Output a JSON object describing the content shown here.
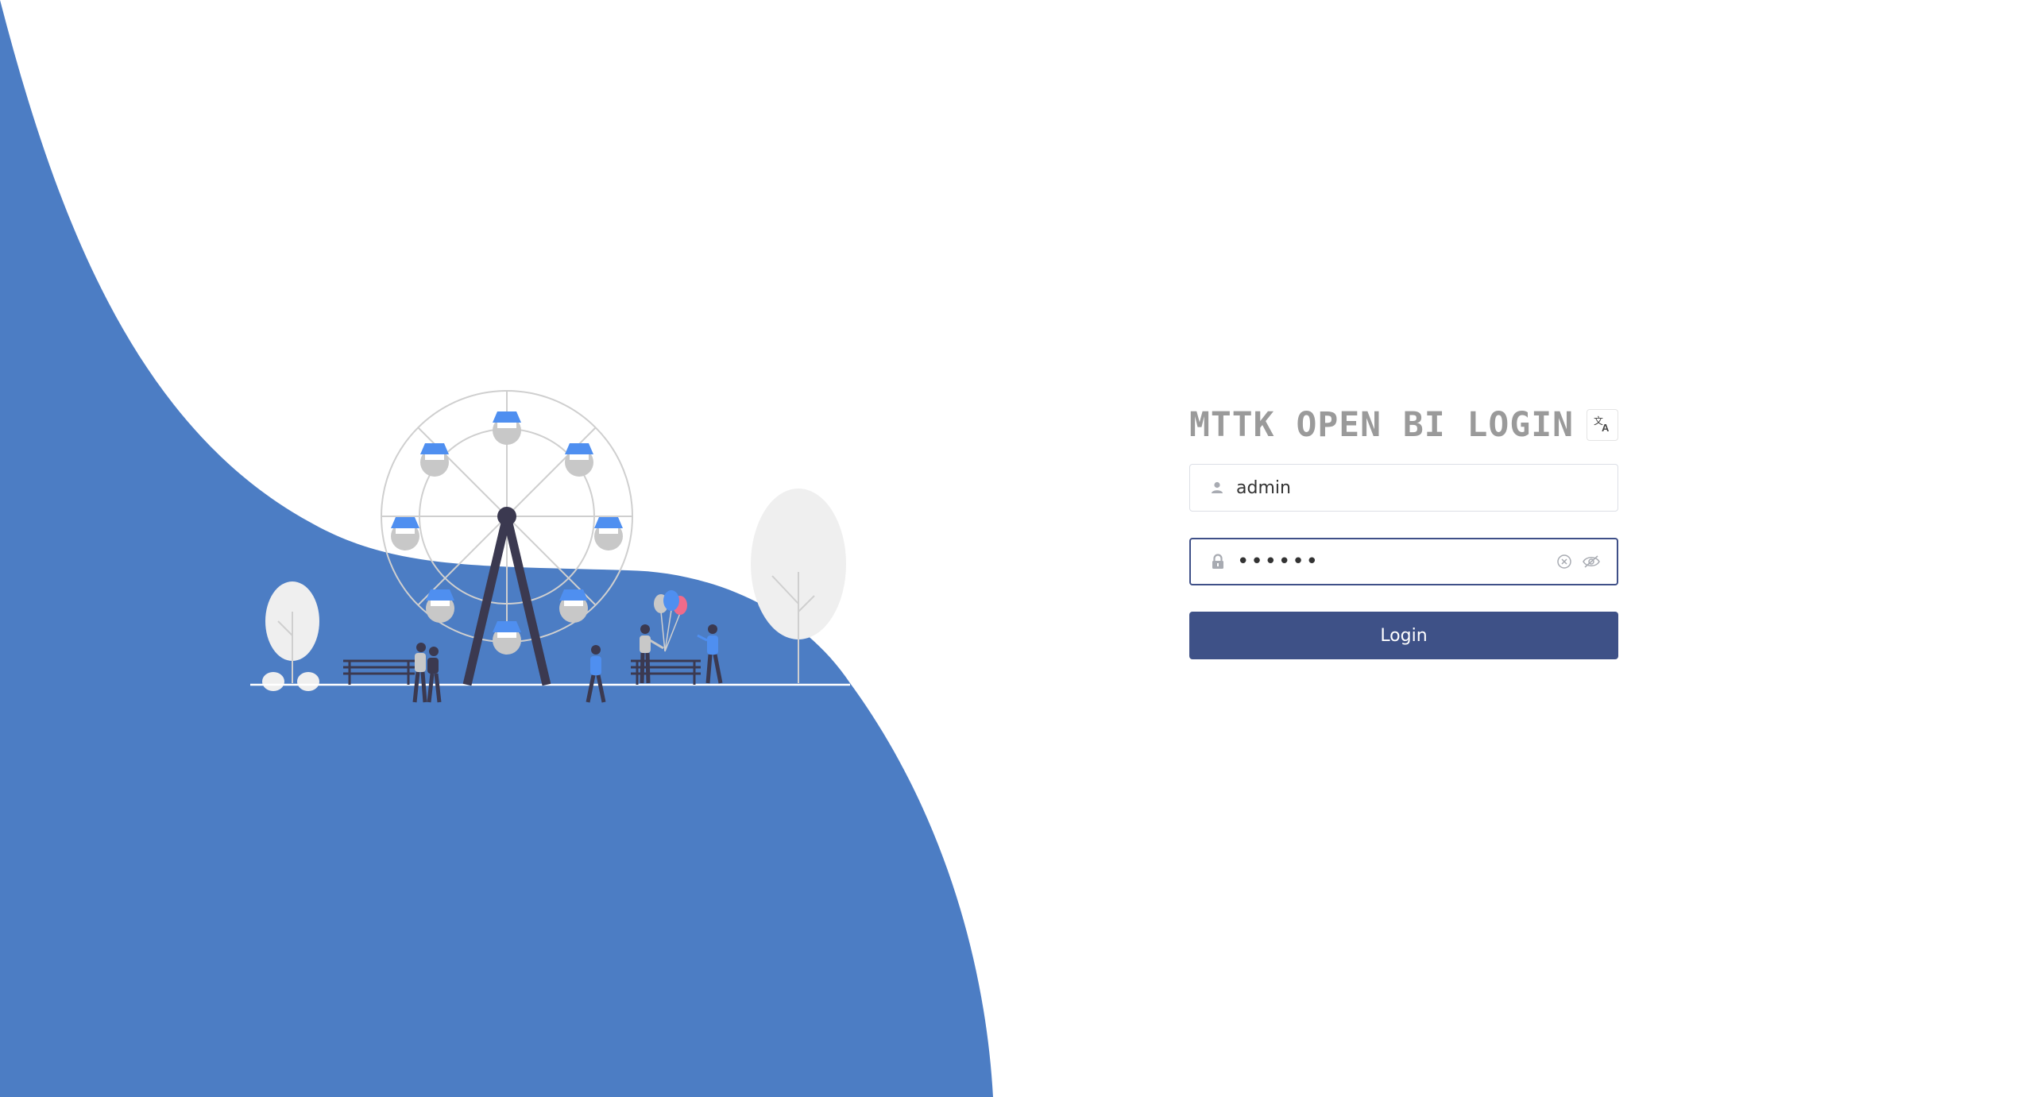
{
  "login": {
    "title": "MTTK OPEN BI LOGIN",
    "language_icon": "translate-icon",
    "username": {
      "value": "admin",
      "icon": "user-icon"
    },
    "password": {
      "value": "••••••",
      "icon": "lock-icon",
      "clear_icon": "clear-icon",
      "toggle_icon": "eye-hidden-icon"
    },
    "submit_label": "Login"
  },
  "colors": {
    "wave": "#4c7dc4",
    "button": "#3e5187",
    "title": "#9a9a9a",
    "accent_blue": "#4f8ff0",
    "balloon_pink": "#f06b8a",
    "dark": "#3b3950",
    "tree": "#efefef"
  }
}
